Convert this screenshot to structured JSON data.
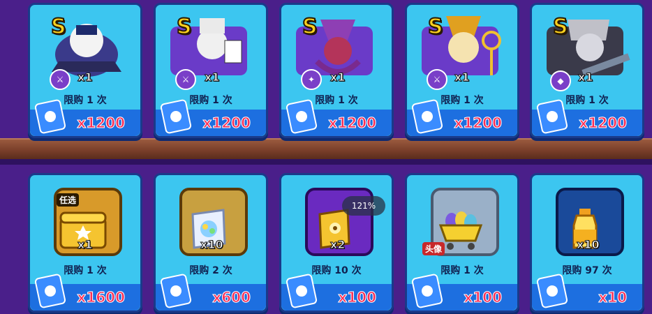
{
  "top_row": [
    {
      "rank": "S",
      "qty": "x1",
      "limit": "限购 1 次",
      "price": "x1200",
      "art": "penguin-pilot",
      "role_icon": "sword-icon"
    },
    {
      "rank": "S",
      "qty": "x1",
      "limit": "限购 1 次",
      "price": "x1200",
      "art": "penguin-magician",
      "role_icon": "sword-icon"
    },
    {
      "rank": "S",
      "qty": "x1",
      "limit": "限购 1 次",
      "price": "x1200",
      "art": "squid-wizard",
      "role_icon": "wand-icon"
    },
    {
      "rank": "S",
      "qty": "x1",
      "limit": "限购 1 次",
      "price": "x1200",
      "art": "penguin-pharaoh",
      "role_icon": "sword-icon"
    },
    {
      "rank": "S",
      "qty": "x1",
      "limit": "限购 1 次",
      "price": "x1200",
      "art": "dark-knight-bird",
      "role_icon": "shield-icon"
    }
  ],
  "bottom_row": [
    {
      "qty": "x1",
      "limit": "限购 1 次",
      "price": "x1600",
      "tag": "任选",
      "art": "golden-chest"
    },
    {
      "qty": "x10",
      "limit": "限购 2 次",
      "price": "x600",
      "tag": "",
      "art": "scroll-card"
    },
    {
      "qty": "x2",
      "limit": "限购 10 次",
      "price": "x100",
      "tag": "",
      "art": "golden-scroll"
    },
    {
      "qty": "",
      "limit": "限购 1 次",
      "price": "x100",
      "tag": "头像",
      "art": "egg-cart"
    },
    {
      "qty": "x10",
      "limit": "限购 97 次",
      "price": "x10",
      "tag": "",
      "art": "potion-bottle"
    }
  ],
  "zoom_level": "121%",
  "colors": {
    "card": "#3cc6f0",
    "price": "#ff2d55",
    "rank": "#ffd21f",
    "background": "#4a1f8a"
  }
}
